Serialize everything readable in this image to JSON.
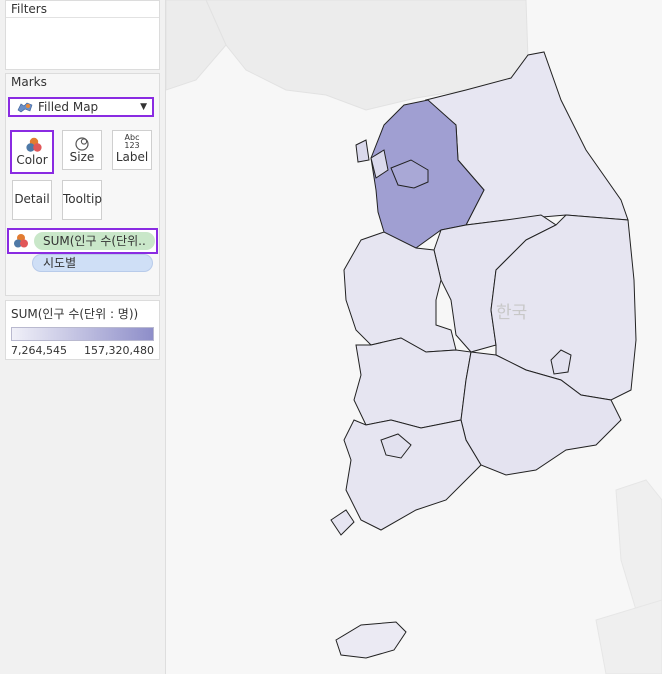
{
  "filters": {
    "title": "Filters"
  },
  "marks": {
    "title": "Marks",
    "mark_type": "Filled Map",
    "buttons": {
      "color": "Color",
      "size": "Size",
      "label": "Label",
      "detail": "Detail",
      "tooltip": "Tooltip"
    },
    "label_icon_text": [
      "Abc",
      "123"
    ],
    "pills": {
      "color_field": "SUM(인구 수(단위..",
      "detail_field": "시도별"
    }
  },
  "legend": {
    "title": "SUM(인구 수(단위 : 명))",
    "min": "7,264,545",
    "max": "157,320,480",
    "color_low": "#f0f0f8",
    "color_high": "#8e8ec9"
  },
  "map": {
    "country_label": "한국",
    "region_colors": {
      "seoul_gyeonggi": "#a09fd2",
      "light": "#e6e5f1",
      "lighter": "#eceaf4",
      "mid": "#e1e0ef"
    }
  },
  "colors": {
    "accent": "#8a2be2"
  }
}
